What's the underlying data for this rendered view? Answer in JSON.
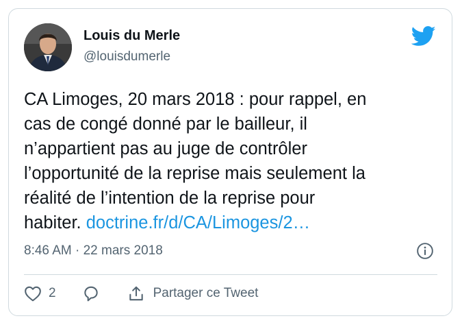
{
  "tweet": {
    "author_name": "Louis du Merle",
    "author_handle": "@louisdumerle",
    "text": "CA Limoges, 20 mars 2018 : pour rappel, en\ncas de congé donné par le bailleur, il\nn’appartient pas au juge de contrôler\nl’opportunité de la reprise mais seulement la\nréalité de l’intention de la reprise pour\nhabiter. ",
    "link_text": "doctrine.fr/d/CA/Limoges/2…",
    "timestamp": "8:46 AM · 22 mars 2018"
  },
  "actions": {
    "like_count": "2",
    "share_label": "Partager ce Tweet"
  },
  "icons": {
    "brand": "twitter-bird-icon",
    "info": "info-icon",
    "like": "heart-icon",
    "reply": "reply-icon",
    "share": "share-icon"
  },
  "colors": {
    "brand_blue": "#1DA1F2",
    "link_blue": "#1b95e0",
    "secondary_text": "#536471",
    "border": "#cfd9de"
  }
}
